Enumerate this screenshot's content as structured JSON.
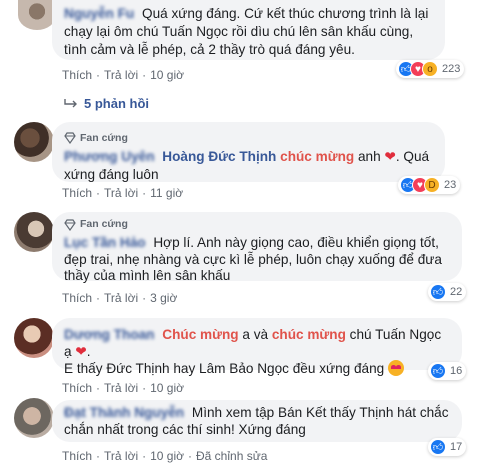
{
  "comments": [
    {
      "name": "Nguyễn Fu",
      "badge": "",
      "text_segments": [
        "Quá xứng đáng. Cứ kết thúc chương trình là lại chạy lại ôm chú Tuấn Ngọc rồi dìu chú lên sân khấu cùng, tình cảm và lễ phép, cả 2 thầy trò quá đáng yêu."
      ],
      "actions": {
        "like": "Thích",
        "reply": "Trả lời",
        "time": "10 giờ"
      },
      "reactions": {
        "icons": [
          "like-icon",
          "love-icon",
          "wow-icon"
        ],
        "count": "223"
      },
      "replies_label": "5 phản hồi"
    },
    {
      "name": "Phương Uyên",
      "badge": "Fan cứng",
      "mention": "Hoàng Đức Thịnh",
      "highlight": "chúc mừng",
      "text_after_highlight": "anh",
      "text_end": ". Quá xứng đáng luôn",
      "actions": {
        "like": "Thích",
        "reply": "Trả lời",
        "time": "11 giờ"
      },
      "reactions": {
        "icons": [
          "like-icon",
          "love-icon",
          "haha-icon"
        ],
        "count": "23"
      }
    },
    {
      "name": "Lục Tần Hảo",
      "badge": "Fan cứng",
      "text": "Hợp lí. Anh này giọng cao, điều khiển giọng tốt, đẹp trai, nhẹ nhàng và cực kì lễ phép, luôn chạy xuống để đưa thầy của mình lên sân khấu",
      "actions": {
        "like": "Thích",
        "reply": "Trả lời",
        "time": "3 giờ"
      },
      "reactions": {
        "icons": [
          "like-icon"
        ],
        "count": "22"
      }
    },
    {
      "name": "Dương Thoan",
      "badge": "",
      "highlight1": "Chúc mừng",
      "text_mid1": "a và",
      "highlight2": "chúc mừng",
      "text_mid2": "chú Tuấn Ngọc ạ",
      "text_line2": "E thấy Đức Thịnh hay Lâm Bảo Ngọc đều xứng đáng",
      "actions": {
        "like": "Thích",
        "reply": "Trả lời",
        "time": "10 giờ"
      },
      "reactions": {
        "icons": [
          "like-icon"
        ],
        "count": "16"
      }
    },
    {
      "name": "Đạt Thành Nguyễn",
      "badge": "",
      "text": "Mình xem tập Bán Kết thấy Thịnh hát chắc chắn nhất trong các thí sinh! Xứng đáng",
      "actions": {
        "like": "Thích",
        "reply": "Trả lời",
        "time": "10 giờ",
        "edited": "Đã chỉnh sửa"
      },
      "reactions": {
        "icons": [
          "like-icon"
        ],
        "count": "17"
      }
    }
  ],
  "colors": {
    "link": "#385898",
    "highlight": "#e0534b",
    "bubble": "#f2f3f5",
    "like": "#1877f2",
    "love": "#f33e58"
  }
}
